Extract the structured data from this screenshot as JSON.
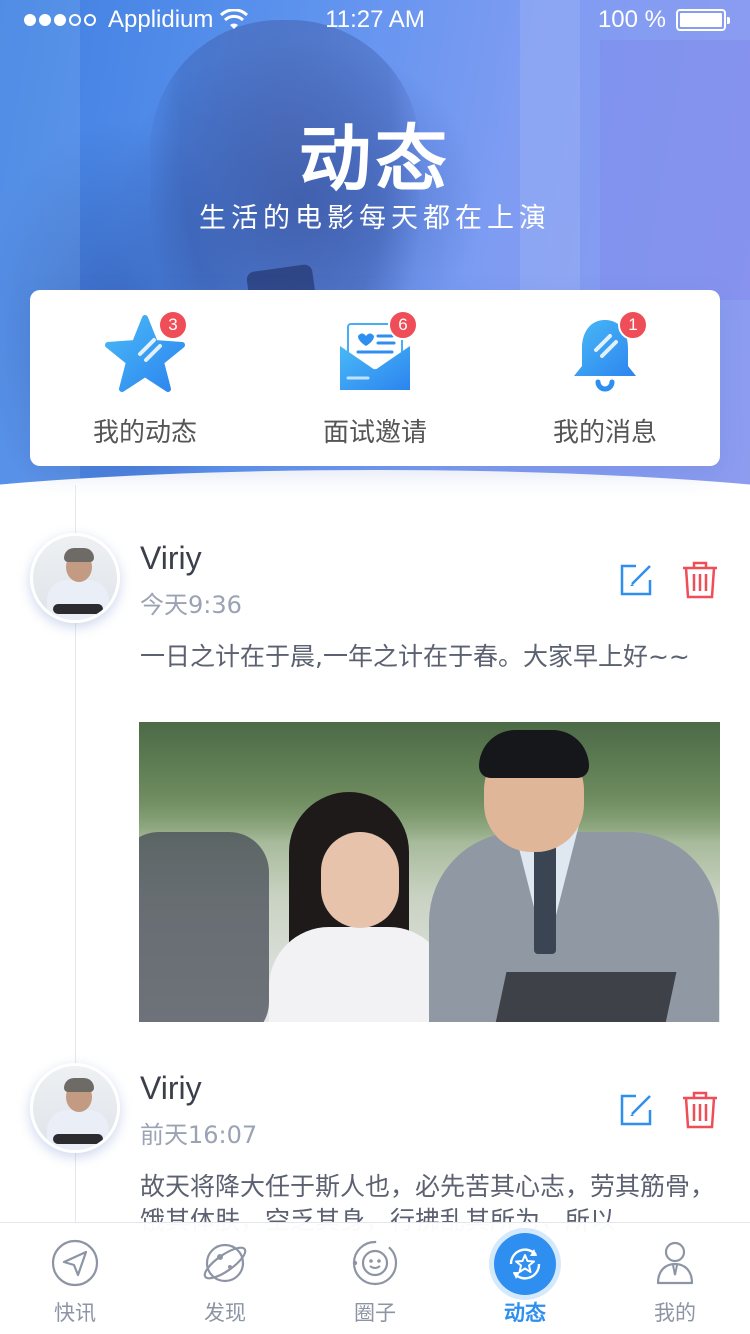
{
  "status_bar": {
    "carrier": "Applidium",
    "time": "11:27 AM",
    "battery": "100 %",
    "signal_dots_filled": 3,
    "signal_dots_total": 5
  },
  "header": {
    "title": "动态",
    "subtitle": "生活的电影每天都在上演"
  },
  "quick_actions": [
    {
      "label": "我的动态",
      "badge": "3",
      "icon": "star-icon"
    },
    {
      "label": "面试邀请",
      "badge": "6",
      "icon": "envelope-icon"
    },
    {
      "label": "我的消息",
      "badge": "1",
      "icon": "bell-icon"
    }
  ],
  "posts": [
    {
      "name": "Viriy",
      "time": "今天9:36",
      "text": "一日之计在于晨,一年之计在于春。大家早上好~~",
      "has_photo": true
    },
    {
      "name": "Viriy",
      "time": "前天16:07",
      "text": "故天将降大任于斯人也，必先苦其心志，劳其筋骨，饿其体肤，空乏其身，行拂乱其所为，所以",
      "has_photo": false
    }
  ],
  "tabs": [
    {
      "label": "快讯",
      "icon": "send-icon",
      "active": false
    },
    {
      "label": "发现",
      "icon": "planet-icon",
      "active": false
    },
    {
      "label": "圈子",
      "icon": "smile-circle-icon",
      "active": false
    },
    {
      "label": "动态",
      "icon": "star-refresh-icon",
      "active": true
    },
    {
      "label": "我的",
      "icon": "user-icon",
      "active": false
    }
  ],
  "colors": {
    "accent": "#2e8ff0",
    "badge": "#ef4d57",
    "delete": "#ef4d57",
    "edit": "#2e8ff0"
  }
}
